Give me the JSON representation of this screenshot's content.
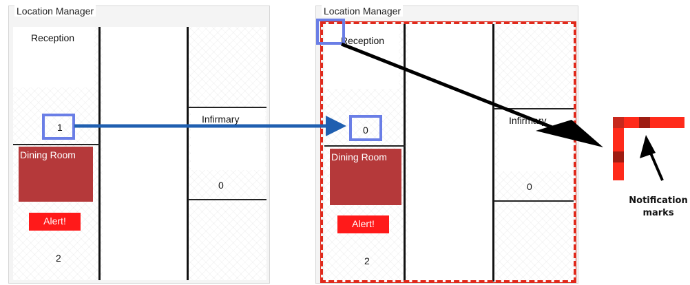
{
  "left_panel": {
    "title": "Location Manager",
    "reception": {
      "label": "Reception",
      "count": "1"
    },
    "dining_room": {
      "label": "Dining Room",
      "alert": "Alert!",
      "count": "2"
    },
    "infirmary": {
      "label": "Infirmary",
      "count": "0"
    }
  },
  "right_panel": {
    "title": "Location Manager",
    "reception": {
      "label": "Reception",
      "count": "0"
    },
    "dining_room": {
      "label": "Dining Room",
      "alert": "Alert!",
      "count": "2"
    },
    "infirmary": {
      "label": "Infirmary",
      "count": "0"
    }
  },
  "callout": {
    "label_line1": "Notification",
    "label_line2": "marks"
  },
  "colors": {
    "highlight_box": "#6a7ee6",
    "notification_border": "#e0291b",
    "dining_room_fill": "#b5393a",
    "alert_fill": "#ff1a1a",
    "arrow_blue": "#1f5fb0"
  }
}
